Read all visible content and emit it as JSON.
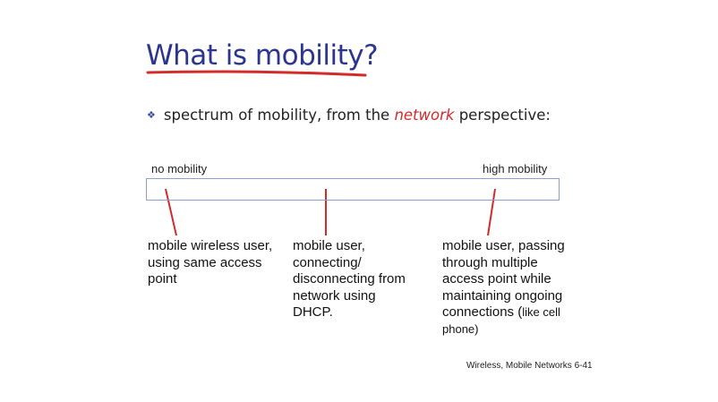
{
  "slide": {
    "title": "What is mobility?",
    "bullet": {
      "text_before": "spectrum of mobility, from the ",
      "emphasis": "network",
      "text_after": " perspective:",
      "icon": "diamond-bullet-icon"
    },
    "scale": {
      "left_label": "no mobility",
      "right_label": "high mobility"
    },
    "columns": [
      {
        "lines": [
          "mobile wireless user,",
          "using same access",
          "point"
        ]
      },
      {
        "lines": [
          "mobile user,",
          "connecting/",
          "disconnecting from",
          "network using",
          "DHCP."
        ]
      },
      {
        "lines": [
          "mobile user, passing",
          "through multiple",
          "access point while",
          "maintaining ongoing"
        ],
        "last_main": "connections (",
        "last_small": "like cell",
        "last_small2": "phone)"
      }
    ],
    "footer": "Wireless, Mobile Networks  6-41",
    "colors": {
      "title": "#2b3590",
      "accent_red": "#d42a2a",
      "bar_border": "#8f9fd0"
    }
  }
}
